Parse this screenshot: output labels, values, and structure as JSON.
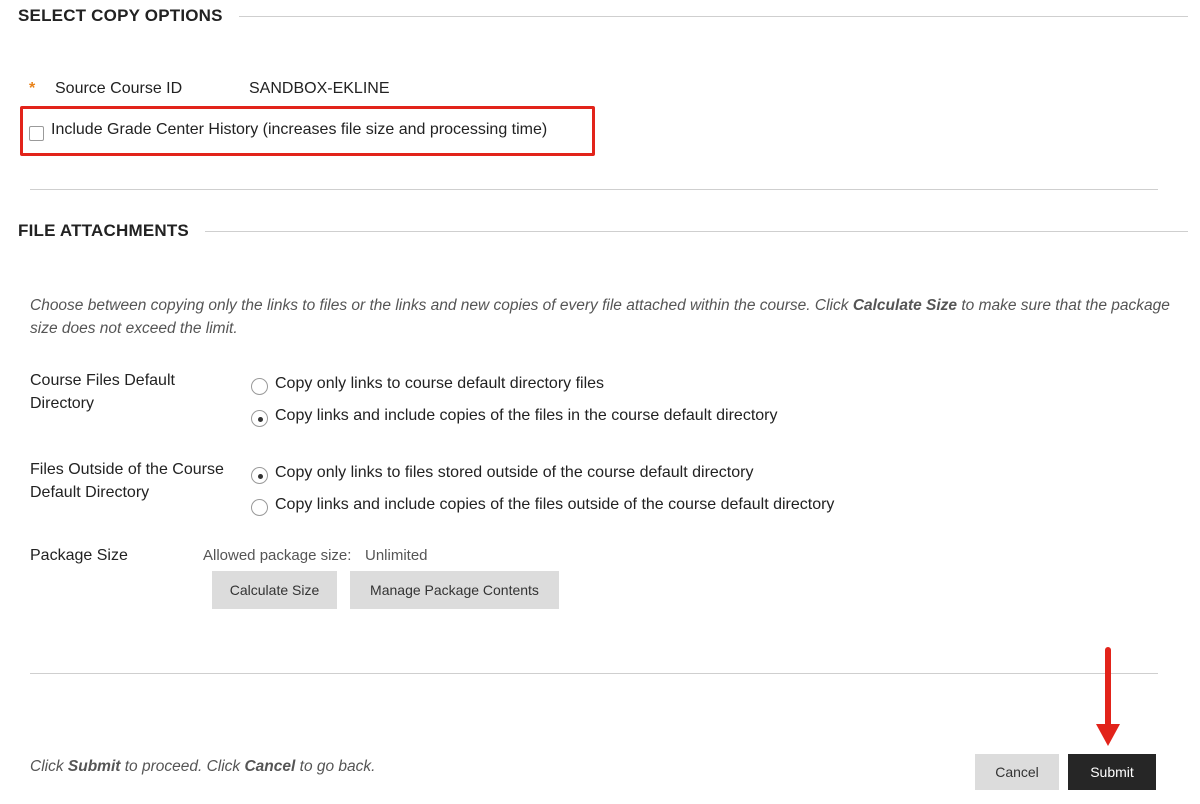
{
  "sections": {
    "copy_options_title": "SELECT COPY OPTIONS",
    "file_attachments_title": "FILE ATTACHMENTS"
  },
  "copy_options": {
    "required_marker": "*",
    "source_course_label": "Source Course ID",
    "source_course_value": "SANDBOX-EKLINE",
    "grade_history_label": "Include Grade Center History (increases file size and processing time)",
    "grade_history_checked": false
  },
  "file_attachments": {
    "instr_part1": "Choose between copying only the links to files or the links and new copies of every file attached within the course. Click ",
    "instr_bold": "Calculate Size",
    "instr_part2": " to make sure that the package size does not exceed the limit.",
    "course_files_label": "Course Files Default Directory",
    "course_files_options": [
      "Copy only links to course default directory files",
      "Copy links and include copies of the files in the course default directory"
    ],
    "course_files_selected": 1,
    "outside_files_label": "Files Outside of the Course Default Directory",
    "outside_files_options": [
      "Copy only links to files stored outside of the course default directory",
      "Copy links and include copies of the files outside of the course default directory"
    ],
    "outside_files_selected": 0,
    "package_size_label": "Package Size",
    "allowed_size_label": "Allowed package size:",
    "allowed_size_value": "Unlimited",
    "calculate_button": "Calculate Size",
    "manage_button": "Manage Package Contents"
  },
  "footer": {
    "text1": "Click ",
    "submit_word": "Submit",
    "text2": " to proceed. Click ",
    "cancel_word": "Cancel",
    "text3": " to go back.",
    "cancel_button": "Cancel",
    "submit_button": "Submit"
  },
  "colors": {
    "highlight": "#e2231a",
    "required_star": "#e8821a",
    "submit_bg": "#262626"
  }
}
